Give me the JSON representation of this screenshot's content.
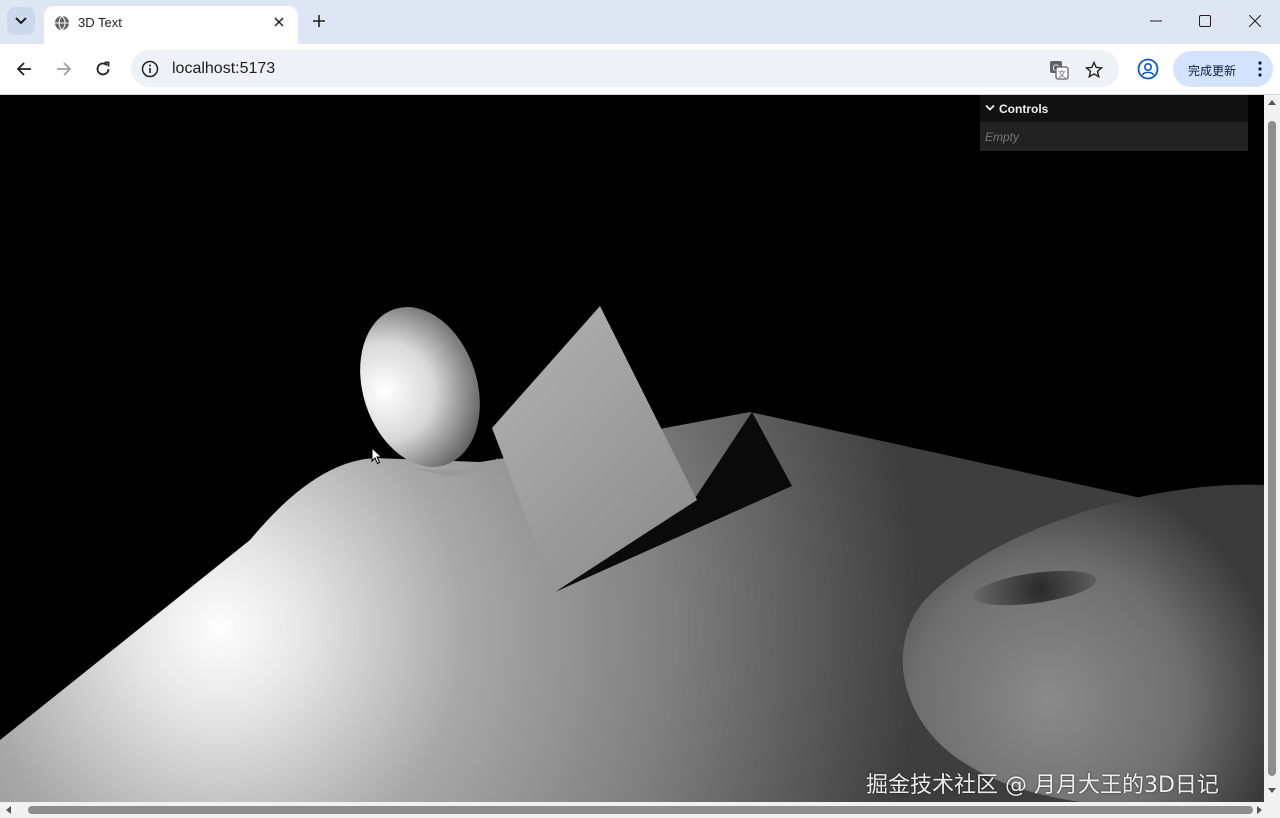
{
  "browser": {
    "tab_title": "3D Text",
    "url": "localhost:5173",
    "update_button_label": "完成更新"
  },
  "controls_panel": {
    "title": "Controls",
    "empty_text": "Empty"
  },
  "watermark": "掘金技术社区 @ 月月大王的3D日记",
  "scene": {
    "objects": [
      "sphere",
      "cube",
      "torus",
      "plane"
    ],
    "background_color": "#000000"
  },
  "icons": [
    "tab-list-icon",
    "globe-icon",
    "close-icon",
    "plus-icon",
    "minimize-icon",
    "maximize-icon",
    "window-close-icon",
    "back-icon",
    "forward-icon",
    "reload-icon",
    "info-icon",
    "translate-icon",
    "star-icon",
    "profile-icon",
    "more-icon",
    "chevron-down-icon",
    "cursor-icon"
  ]
}
